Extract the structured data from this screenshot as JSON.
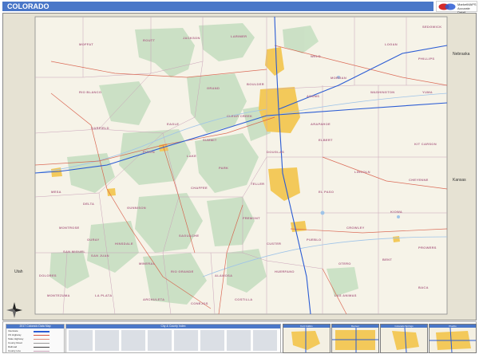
{
  "title": "COLORADO",
  "logo": {
    "text_line1": "MarketMAPS",
    "text_line2": "Accurate Detail",
    "brand_colors": [
      "#d42a2a",
      "#2a5bd4"
    ]
  },
  "colors": {
    "title_bar": "#4a77c8",
    "map_background": "#f3efe2",
    "neighbor_states": "#e6e2d3",
    "forest": "#c9e0c4",
    "urban": "#f3c95a",
    "county_labels": "#b06a8a",
    "interstates": "#2a5bd4",
    "highways": "#d6543e",
    "water": "#9fc4e8"
  },
  "neighbors": {
    "nebraska": "Nebraska",
    "kansas": "Kansas",
    "utah": "Utah"
  },
  "counties": {
    "moffat": "MOFFAT",
    "routt": "ROUTT",
    "jackson": "JACKSON",
    "larimer": "LARIMER",
    "weld": "WELD",
    "logan": "LOGAN",
    "sedgwick": "SEDGWICK",
    "phillips": "PHILLIPS",
    "morgan": "MORGAN",
    "washington": "WASHINGTON",
    "yuma": "YUMA",
    "rio_blanco": "RIO BLANCO",
    "garfield": "GARFIELD",
    "eagle": "EAGLE",
    "grand": "GRAND",
    "boulder": "BOULDER",
    "adams": "ADAMS",
    "arapahoe": "ARAPAHOE",
    "douglas": "DOUGLAS",
    "elbert": "ELBERT",
    "lincoln": "LINCOLN",
    "kit_carson": "KIT CARSON",
    "cheyenne": "CHEYENNE",
    "el_paso": "EL PASO",
    "teller": "TELLER",
    "park": "PARK",
    "mesa": "MESA",
    "delta": "DELTA",
    "montrose": "MONTROSE",
    "gunnison": "GUNNISON",
    "chaffee": "CHAFFEE",
    "fremont": "FREMONT",
    "pueblo": "PUEBLO",
    "crowley": "CROWLEY",
    "kiowa": "KIOWA",
    "otero": "OTERO",
    "bent": "BENT",
    "prowers": "PROWERS",
    "saguache": "SAGUACHE",
    "custer": "CUSTER",
    "huerfano": "HUERFANO",
    "las_animas": "LAS ANIMAS",
    "baca": "BACA",
    "san_miguel": "SAN MIGUEL",
    "dolores": "DOLORES",
    "montezuma": "MONTEZUMA",
    "la_plata": "LA PLATA",
    "archuleta": "ARCHULETA",
    "rio_grande": "RIO GRANDE",
    "alamosa": "ALAMOSA",
    "conejos": "CONEJOS",
    "costilla": "COSTILLA",
    "mineral": "MINERAL",
    "hinsdale": "HINSDALE",
    "ouray": "OURAY",
    "san_juan": "SAN JUAN",
    "lake": "LAKE",
    "summit": "SUMMIT",
    "pitkin": "PITKIN",
    "clear_creek": "CLEAR CREEK"
  },
  "legend": {
    "title": "2017 Colorado Data Map",
    "rows": [
      "Interstate",
      "US Highway",
      "State Highway",
      "County Road",
      "Railroad",
      "County Line"
    ]
  },
  "index": {
    "title": "City & County Index"
  },
  "insets": [
    {
      "title": "Fort Collins"
    },
    {
      "title": "Denver"
    },
    {
      "title": "Colorado Springs"
    },
    {
      "title": "Pueblo"
    }
  ]
}
